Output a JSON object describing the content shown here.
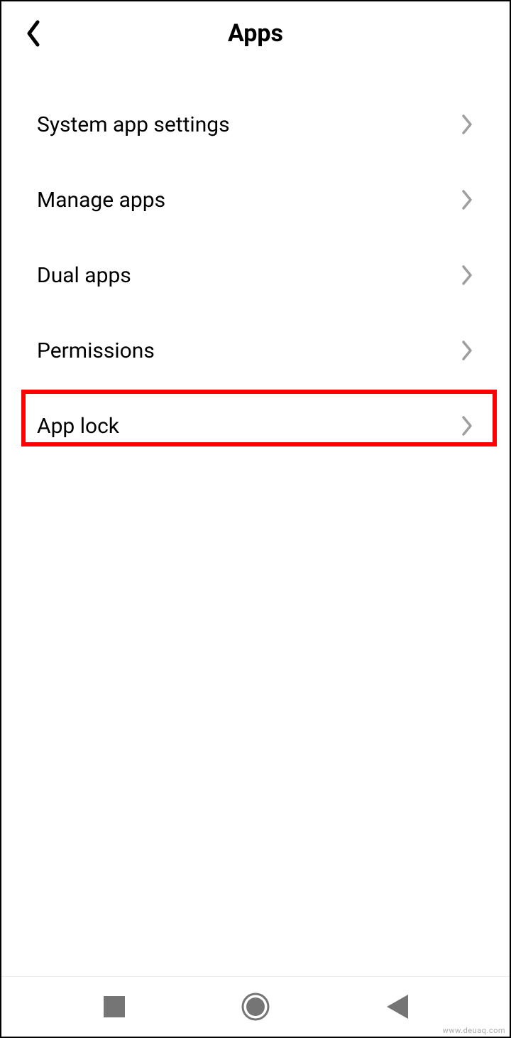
{
  "header": {
    "title": "Apps"
  },
  "items": [
    {
      "label": "System app settings"
    },
    {
      "label": "Manage apps"
    },
    {
      "label": "Dual apps"
    },
    {
      "label": "Permissions"
    },
    {
      "label": "App lock"
    }
  ],
  "highlight": {
    "index": 4,
    "color": "#ff0000"
  },
  "watermark": "www.deuaq.com",
  "colors": {
    "chevron": "#9e9e9e",
    "nav_icon": "#757575"
  }
}
